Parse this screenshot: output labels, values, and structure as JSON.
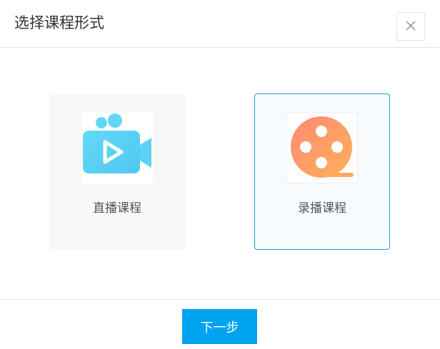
{
  "dialog": {
    "title": "选择课程形式",
    "close_icon": "close-icon"
  },
  "options": [
    {
      "label": "直播课程",
      "icon": "video-camera-icon",
      "selected": false,
      "icon_color": "#5ad3f5"
    },
    {
      "label": "录播课程",
      "icon": "film-reel-icon",
      "selected": true,
      "icon_color": "#ff9a6a"
    }
  ],
  "footer": {
    "next_label": "下一步"
  },
  "colors": {
    "accent": "#00a3f0",
    "selected_border": "#1ba3c4"
  }
}
